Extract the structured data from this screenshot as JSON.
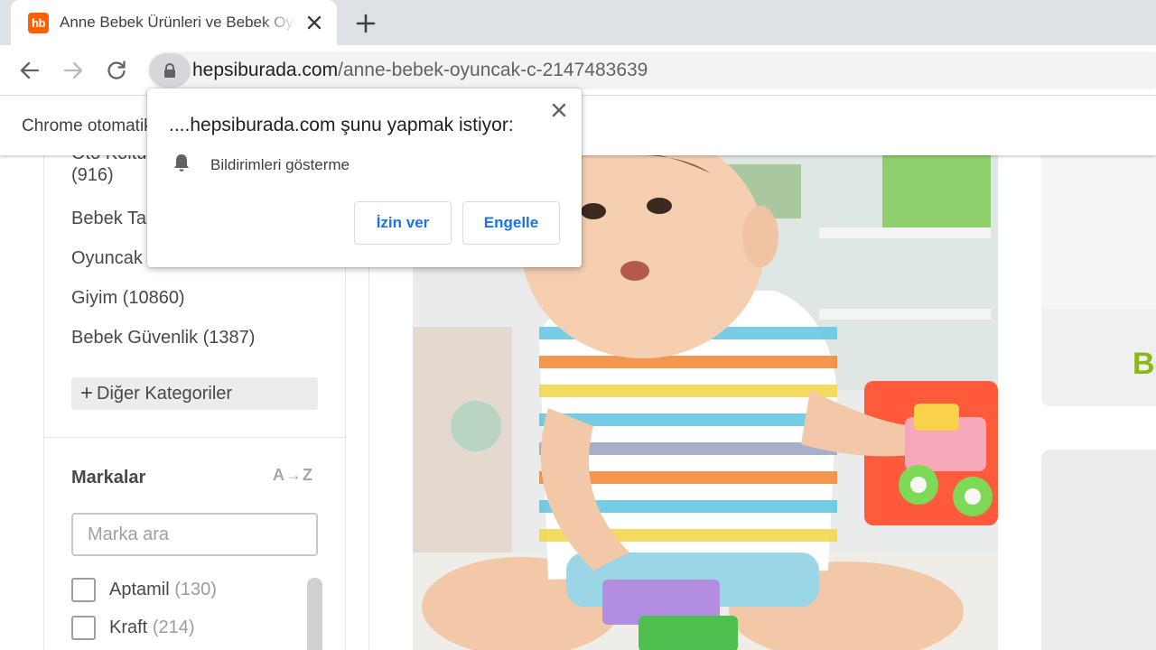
{
  "browser": {
    "tab": {
      "favicon_text": "hb",
      "title": "Anne Bebek Ürünleri ve Bebek Oyuncakları"
    },
    "address": {
      "host": "hepsiburada.com",
      "path": "/anne-bebek-oyuncak-c-2147483639"
    },
    "infobar_text": "Chrome otomatik test yazılımı tarafından kontrol ediliyor."
  },
  "permission_popup": {
    "title": "....hepsiburada.com şunu yapmak istiyor:",
    "permission": "Bildirimleri gösterme",
    "allow_label": "İzin ver",
    "block_label": "Engelle"
  },
  "sidebar": {
    "categories": [
      {
        "label": "Oto Koltuğu",
        "count": "(916)"
      },
      {
        "label": "Bebek Taşıma"
      },
      {
        "label": "Oyuncak"
      },
      {
        "label": "Giyim (10860)"
      },
      {
        "label": "Bebek Güvenlik (1387)"
      }
    ],
    "more_categories": "Diğer Kategoriler",
    "brands": {
      "title": "Markalar",
      "sort_label": "A→Z",
      "search_placeholder": "Marka ara",
      "items": [
        {
          "name": "Aptamil",
          "count": "(130)"
        },
        {
          "name": "Kraft",
          "count": "(214)"
        }
      ]
    }
  },
  "right_panel": {
    "banner_text": "Be"
  },
  "colors": {
    "brand_orange": "#ff6000",
    "link_blue": "#1a73e8",
    "accent_green": "#8ab819"
  }
}
